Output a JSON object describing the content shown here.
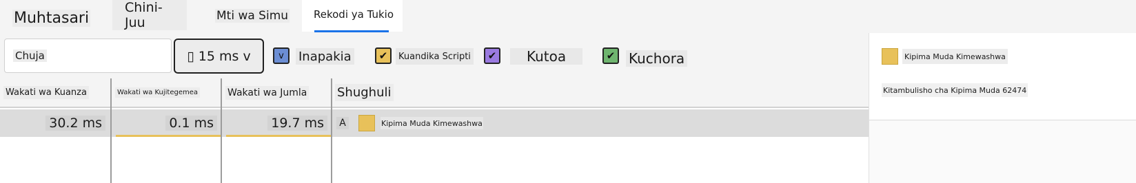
{
  "tabs": [
    "Muhtasari",
    "Chini-Juu",
    "Mti wa Simu",
    "Rekodi ya Tukio"
  ],
  "toolbar": {
    "filter_value": "Chuja",
    "duration_label": "▯ 15 ms v",
    "checkboxes": [
      {
        "label": "Inapakia",
        "checked": true,
        "color": "#6c8ed4"
      },
      {
        "label": "Kuandika Scripti",
        "checked": true,
        "color": "#e8c15a"
      },
      {
        "label": "Kutoa",
        "checked": true,
        "color": "#9a7ae0"
      },
      {
        "label": "Kuchora",
        "checked": true,
        "color": "#6fb56f"
      }
    ]
  },
  "table": {
    "headers": [
      "Wakati wa Kuanza",
      "Wakati wa Kujitegemea",
      "Wakati wa Jumla",
      "Shughuli"
    ],
    "row": {
      "start": "30.2 ms",
      "self": "0.1 ms",
      "total": "19.7 ms",
      "expand": "A",
      "activity": "Kipima Muda Kimewashwa",
      "activity_color": "#e8c15a"
    }
  },
  "details": {
    "title": "Kipima Muda Kimewashwa",
    "title_color": "#e8c15a",
    "timer_id": "Kitambulisho cha Kipima Muda 62474"
  }
}
